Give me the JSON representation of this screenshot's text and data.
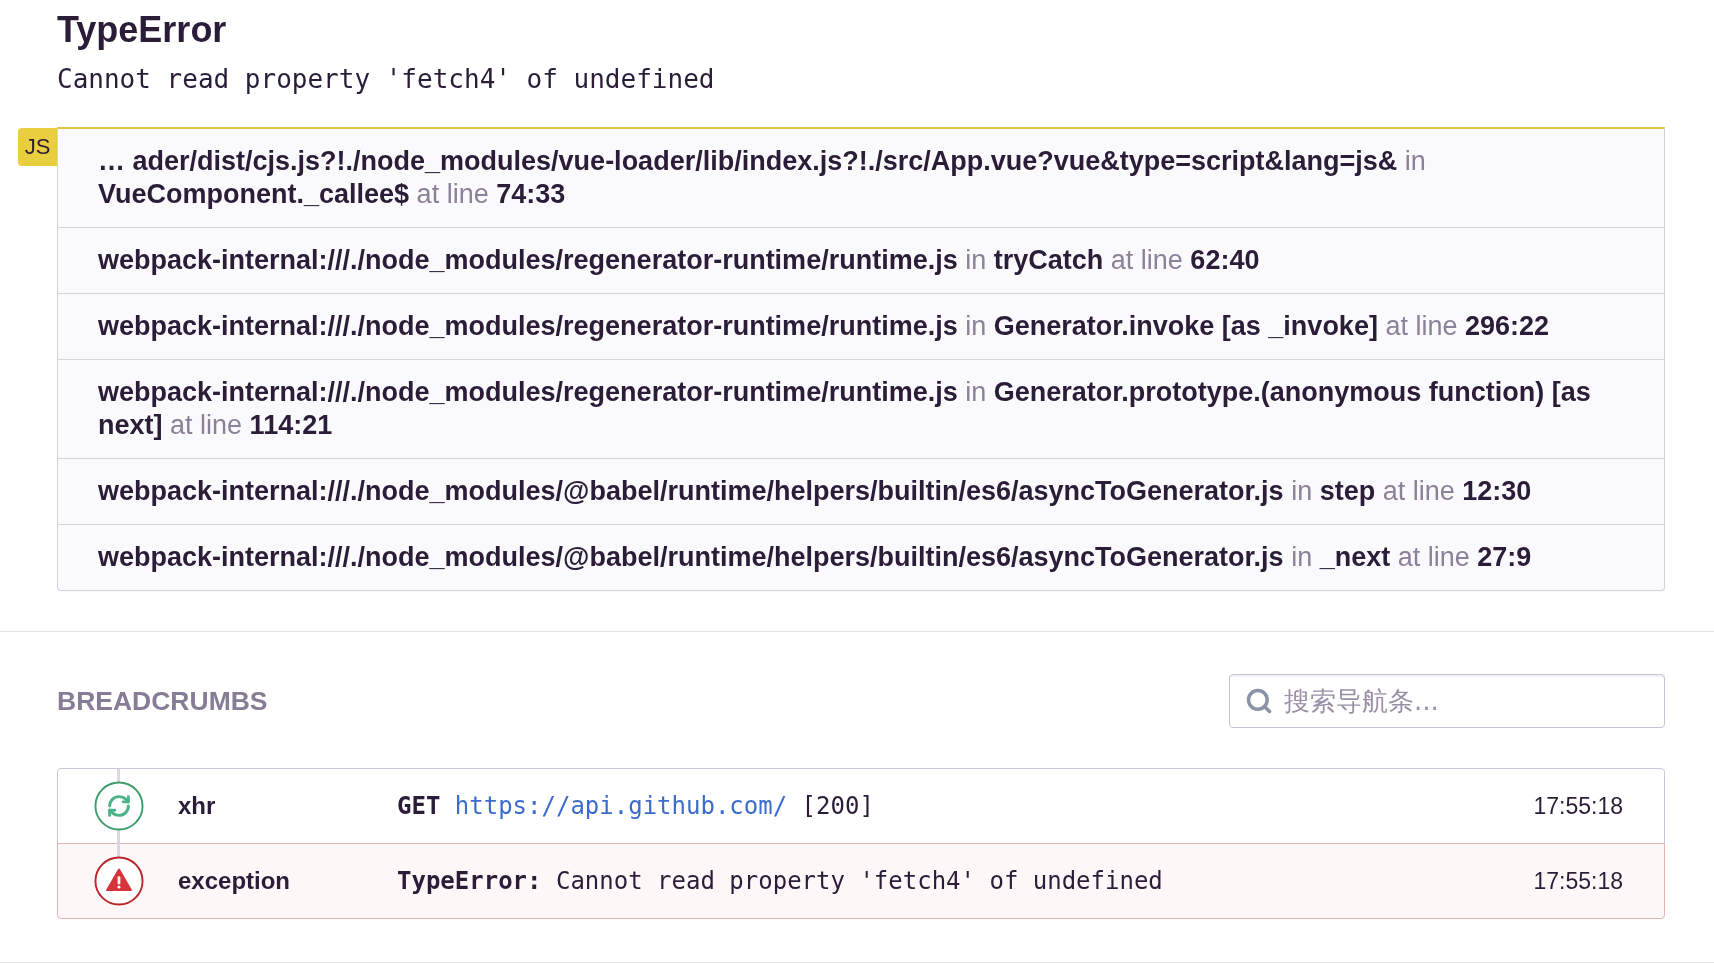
{
  "error": {
    "title": "TypeError",
    "message": "Cannot read property 'fetch4' of undefined"
  },
  "stack_trace": {
    "platform_badge": "JS",
    "frames": [
      {
        "filename": "… ader/dist/cjs.js?!./node_modules/vue-loader/lib/index.js?!./src/App.vue?vue&type=script&lang=js&",
        "in": "in",
        "function": "VueComponent._callee$",
        "at": "at line",
        "line": "74:33"
      },
      {
        "filename": "webpack-internal:///./node_modules/regenerator-runtime/runtime.js",
        "in": "in",
        "function": "tryCatch",
        "at": "at line",
        "line": "62:40"
      },
      {
        "filename": "webpack-internal:///./node_modules/regenerator-runtime/runtime.js",
        "in": "in",
        "function": "Generator.invoke [as _invoke]",
        "at": "at line",
        "line": "296:22"
      },
      {
        "filename": "webpack-internal:///./node_modules/regenerator-runtime/runtime.js",
        "in": "in",
        "function": "Generator.prototype.(anonymous function) [as next]",
        "at": "at line",
        "line": "114:21"
      },
      {
        "filename": "webpack-internal:///./node_modules/@babel/runtime/helpers/builtin/es6/asyncToGenerator.js",
        "in": "in",
        "function": "step",
        "at": "at line",
        "line": "12:30"
      },
      {
        "filename": "webpack-internal:///./node_modules/@babel/runtime/helpers/builtin/es6/asyncToGenerator.js",
        "in": "in",
        "function": "_next",
        "at": "at line",
        "line": "27:9"
      }
    ]
  },
  "breadcrumbs": {
    "title": "BREADCRUMBS",
    "search": {
      "placeholder": "搜索导航条..."
    },
    "items": [
      {
        "kind": "http",
        "type": "xhr",
        "method": "GET",
        "url": "https://api.github.com/",
        "status": "[200]",
        "time": "17:55:18"
      },
      {
        "kind": "error",
        "type": "exception",
        "message": "**TypeError:** Cannot read property 'fetch4' of undefined",
        "time": "17:55:18"
      }
    ]
  }
}
